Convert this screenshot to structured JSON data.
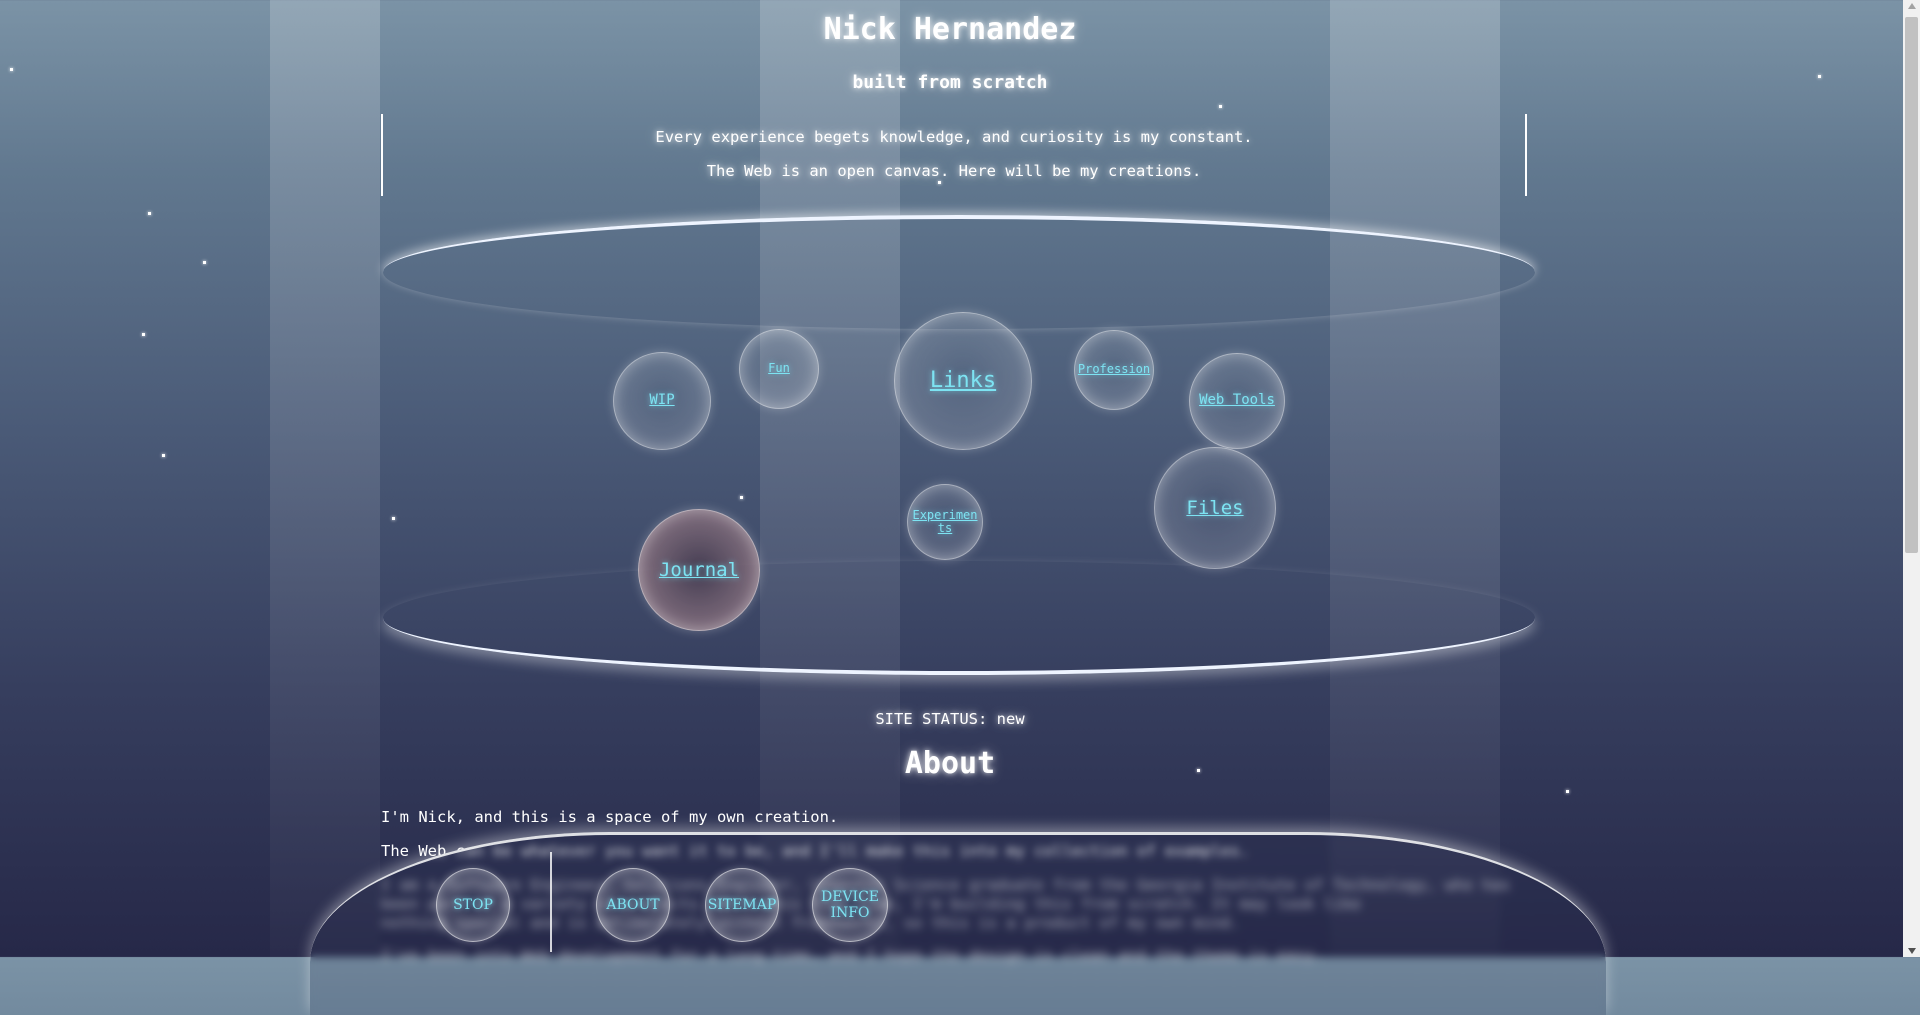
{
  "header": {
    "title": "Nick Hernandez",
    "subtitle": "built from scratch",
    "tagline": [
      "Every experience begets knowledge, and curiosity is my constant.",
      "The Web is an open canvas. Here will be my creations."
    ]
  },
  "bubbles": {
    "wip": "WIP",
    "fun": "Fun",
    "links": "Links",
    "profession": "Profession",
    "web_tools": "Web Tools",
    "journal": "Journal",
    "experiments": "Experiments",
    "files": "Files"
  },
  "status": {
    "text": "SITE STATUS: new"
  },
  "about": {
    "heading": "About",
    "p1": "I'm Nick, and this is a space of my own creation.",
    "p2": "The Web can be whatever you want it to be, and I'll make this into my collection of examples.",
    "p3a": "I am a Software Engineer, Solutions Engineer, Computer Science graduate from the Georgia Institute of Technology, who has",
    "p3b": "been part of a variety of projects. With this free time, I'm building this from scratch. It may look like",
    "p3c": "nothing special and is deliberately without frameworks, so this is a product of my own mind.",
    "p4": "I've been into Web development for a long time, and I hope the design is clean and the theme is easy."
  },
  "dock": {
    "stop": "STOP",
    "about": "ABOUT",
    "sitemap": "SITEMAP",
    "device_info": "DEVICE INFO"
  }
}
